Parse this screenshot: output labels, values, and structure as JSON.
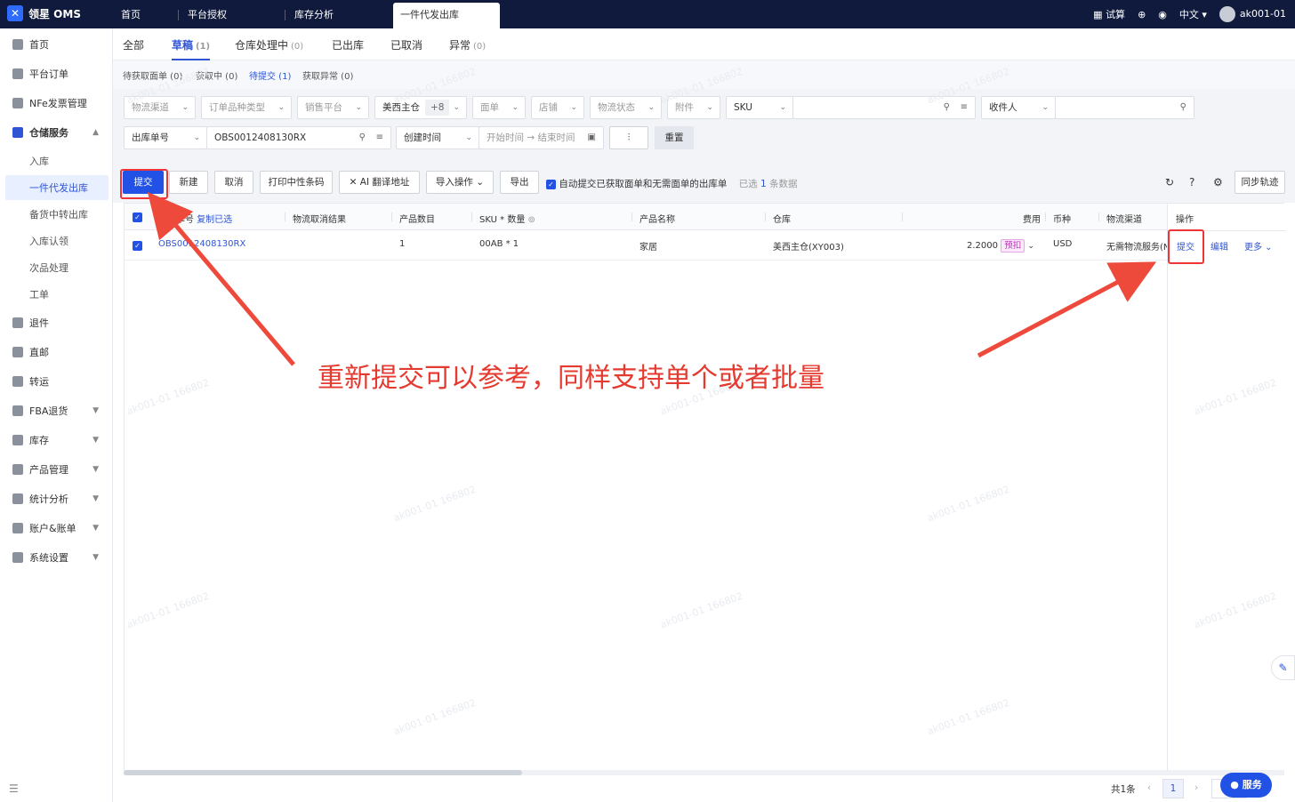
{
  "app": {
    "name": "领星 OMS",
    "user": "ak001-01"
  },
  "top_tabs": [
    {
      "label": "首页"
    },
    {
      "label": "平台授权"
    },
    {
      "label": "库存分析"
    },
    {
      "label": "一件代发出库"
    }
  ],
  "top_right": {
    "calc": "试算",
    "lang": "中文"
  },
  "sidebar": {
    "items": [
      {
        "label": "首页"
      },
      {
        "label": "平台订单"
      },
      {
        "label": "NFe发票管理"
      },
      {
        "label": "仓储服务"
      },
      {
        "label": "入库"
      },
      {
        "label": "一件代发出库"
      },
      {
        "label": "备货中转出库"
      },
      {
        "label": "入库认领"
      },
      {
        "label": "次品处理"
      },
      {
        "label": "工单"
      },
      {
        "label": "退件"
      },
      {
        "label": "直邮"
      },
      {
        "label": "转运"
      },
      {
        "label": "FBA退货"
      },
      {
        "label": "库存"
      },
      {
        "label": "产品管理"
      },
      {
        "label": "统计分析"
      },
      {
        "label": "账户&账单"
      },
      {
        "label": "系统设置"
      }
    ]
  },
  "status_tabs": [
    {
      "label": "全部",
      "count": ""
    },
    {
      "label": "草稿",
      "count": "(1)"
    },
    {
      "label": "仓库处理中",
      "count": "(0)"
    },
    {
      "label": "已出库",
      "count": ""
    },
    {
      "label": "已取消",
      "count": ""
    },
    {
      "label": "异常",
      "count": "(0)"
    }
  ],
  "sub_tabs": [
    {
      "label": "待获取面单 (0)"
    },
    {
      "label": "获取中 (0)"
    },
    {
      "label": "待提交 (1)"
    },
    {
      "label": "获取异常 (0)"
    }
  ],
  "filters": {
    "row1": [
      "物流渠道",
      "订单品种类型",
      "销售平台",
      "美西主仓",
      "+8",
      "面单",
      "店铺",
      "物流状态",
      "附件",
      "SKU",
      "收件人"
    ],
    "row2": {
      "order_type": "出库单号",
      "order_no": "OBS0012408130RX",
      "time_type": "创建时间",
      "start_placeholder": "开始时间",
      "end_placeholder": "结束时间",
      "reset": "重置"
    }
  },
  "toolbar": {
    "submit": "提交",
    "create": "新建",
    "cancel": "取消",
    "print": "打印中性条码",
    "ai_translate": "AI 翻译地址",
    "import": "导入操作",
    "export": "导出",
    "auto_submit": "自动提交已获取面单和无需面单的出库单",
    "selected_prefix": "已选",
    "selected_count": "1",
    "selected_suffix": "条数据",
    "sync": "同步轨迹"
  },
  "table": {
    "headers": {
      "order_no": "单号",
      "copy_selected": "复制已选",
      "logistics_cancel": "物流取消结果",
      "product_qty": "产品数目",
      "sku_qty": "SKU * 数量",
      "product_name": "产品名称",
      "warehouse": "仓库",
      "fee": "费用",
      "currency": "币种",
      "channel": "物流渠道",
      "ops": "操作"
    },
    "rows": [
      {
        "order_no": "OBS0012408130RX",
        "product_qty": "1",
        "sku_qty": "00AB * 1",
        "product_name": "家居",
        "warehouse": "美西主仓(XY003)",
        "fee": "2.2000",
        "fee_tag": "预扣",
        "currency": "USD",
        "channel": "无需物流服务(N",
        "op_submit": "提交",
        "op_edit": "编辑",
        "op_more": "更多"
      }
    ]
  },
  "annotation": "重新提交可以参考，同样支持单个或者批量",
  "footer": {
    "total": "共1条",
    "page": "1"
  },
  "service_button": "服务",
  "watermark": "ak001-01 166802",
  "colors": {
    "brand": "#2151e5",
    "annotation_red": "#e53a2f",
    "topbar": "#0f1a3d"
  }
}
